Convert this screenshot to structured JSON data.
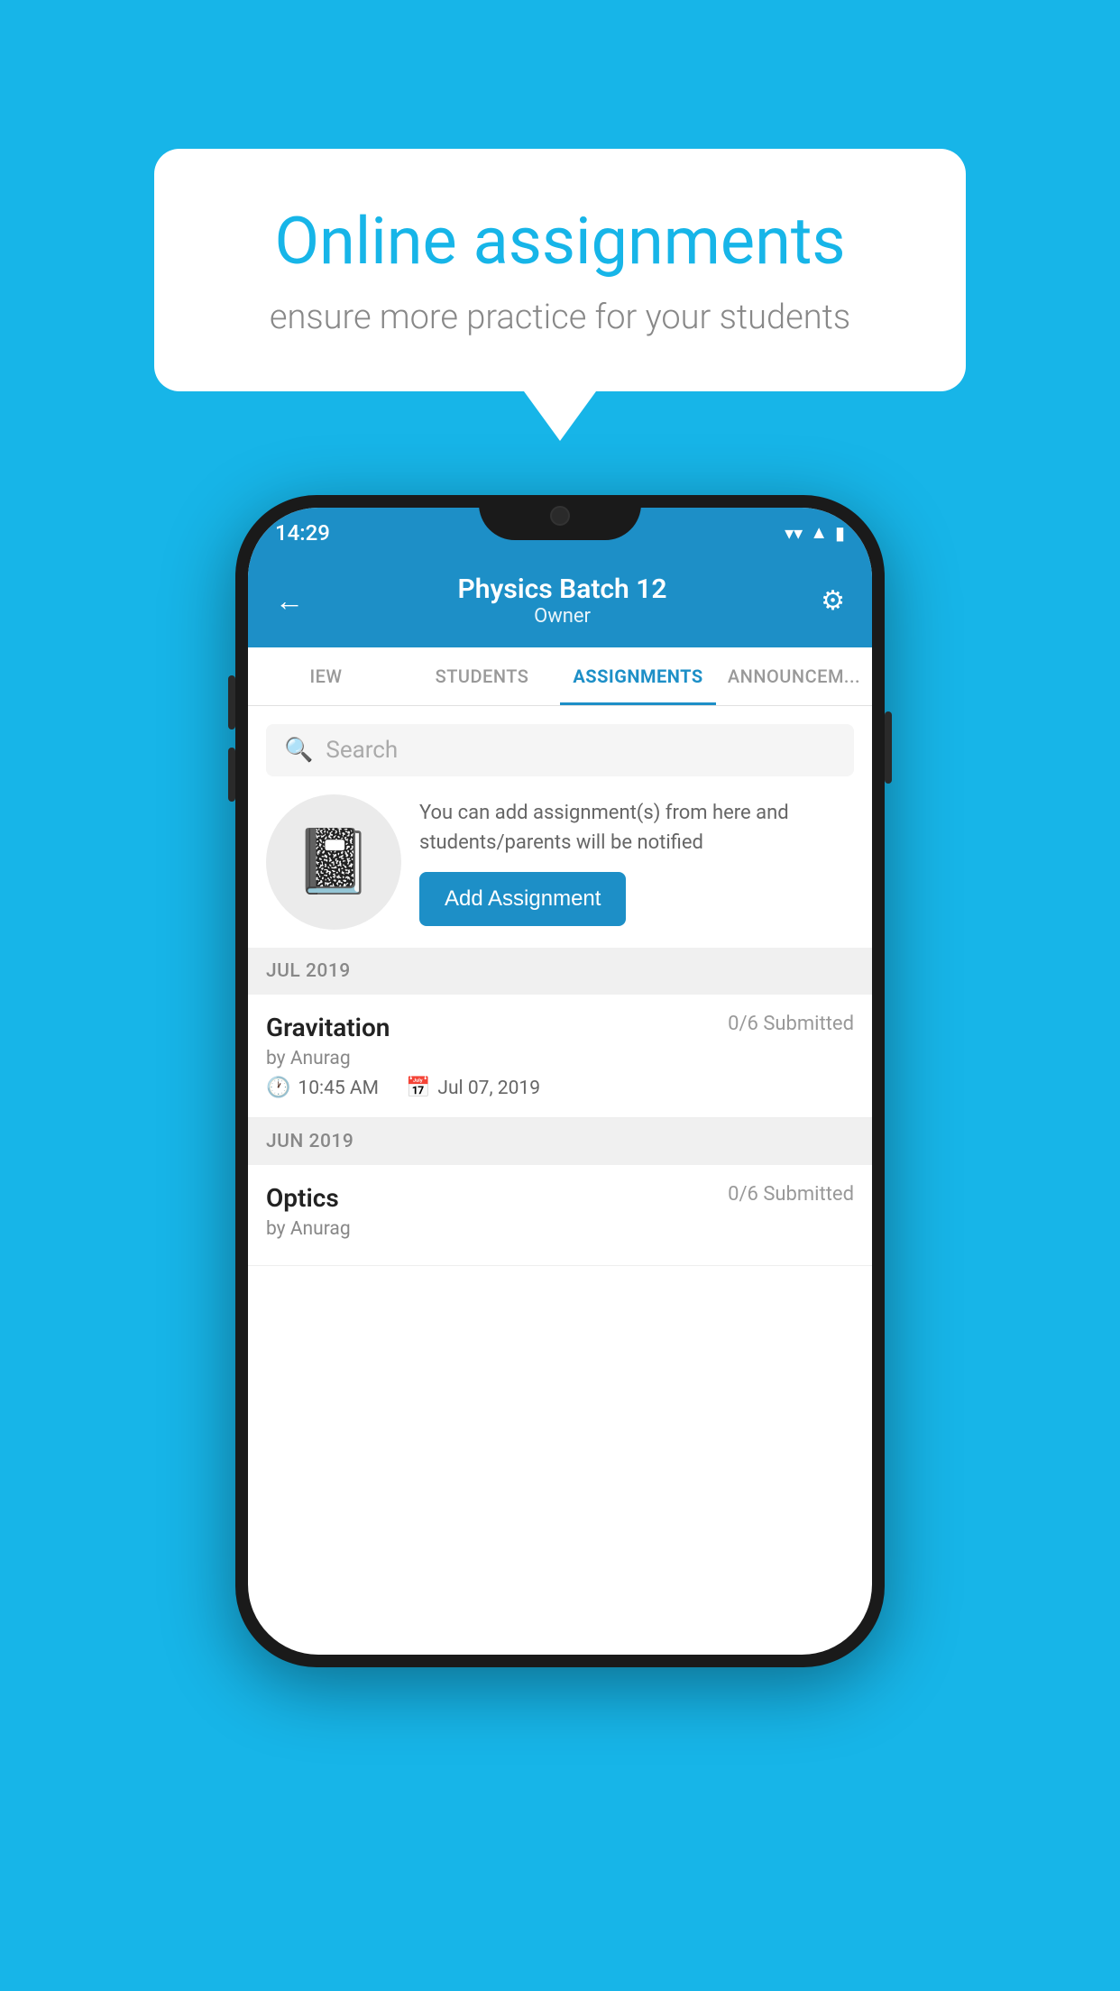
{
  "background_color": "#17B5E8",
  "speech_bubble": {
    "title": "Online assignments",
    "subtitle": "ensure more practice for your students"
  },
  "status_bar": {
    "time": "14:29",
    "icons": [
      "wifi",
      "signal",
      "battery"
    ]
  },
  "header": {
    "title": "Physics Batch 12",
    "subtitle": "Owner",
    "back_label": "←",
    "settings_label": "⚙"
  },
  "tabs": [
    {
      "label": "IEW",
      "active": false
    },
    {
      "label": "STUDENTS",
      "active": false
    },
    {
      "label": "ASSIGNMENTS",
      "active": true
    },
    {
      "label": "ANNOUNCEMENTS",
      "active": false
    }
  ],
  "search": {
    "placeholder": "Search"
  },
  "promo": {
    "description": "You can add assignment(s) from here and students/parents will be notified",
    "button_label": "Add Assignment"
  },
  "sections": [
    {
      "month_label": "JUL 2019",
      "assignments": [
        {
          "name": "Gravitation",
          "submitted": "0/6 Submitted",
          "author": "by Anurag",
          "time": "10:45 AM",
          "date": "Jul 07, 2019"
        }
      ]
    },
    {
      "month_label": "JUN 2019",
      "assignments": [
        {
          "name": "Optics",
          "submitted": "0/6 Submitted",
          "author": "by Anurag",
          "time": "",
          "date": ""
        }
      ]
    }
  ]
}
